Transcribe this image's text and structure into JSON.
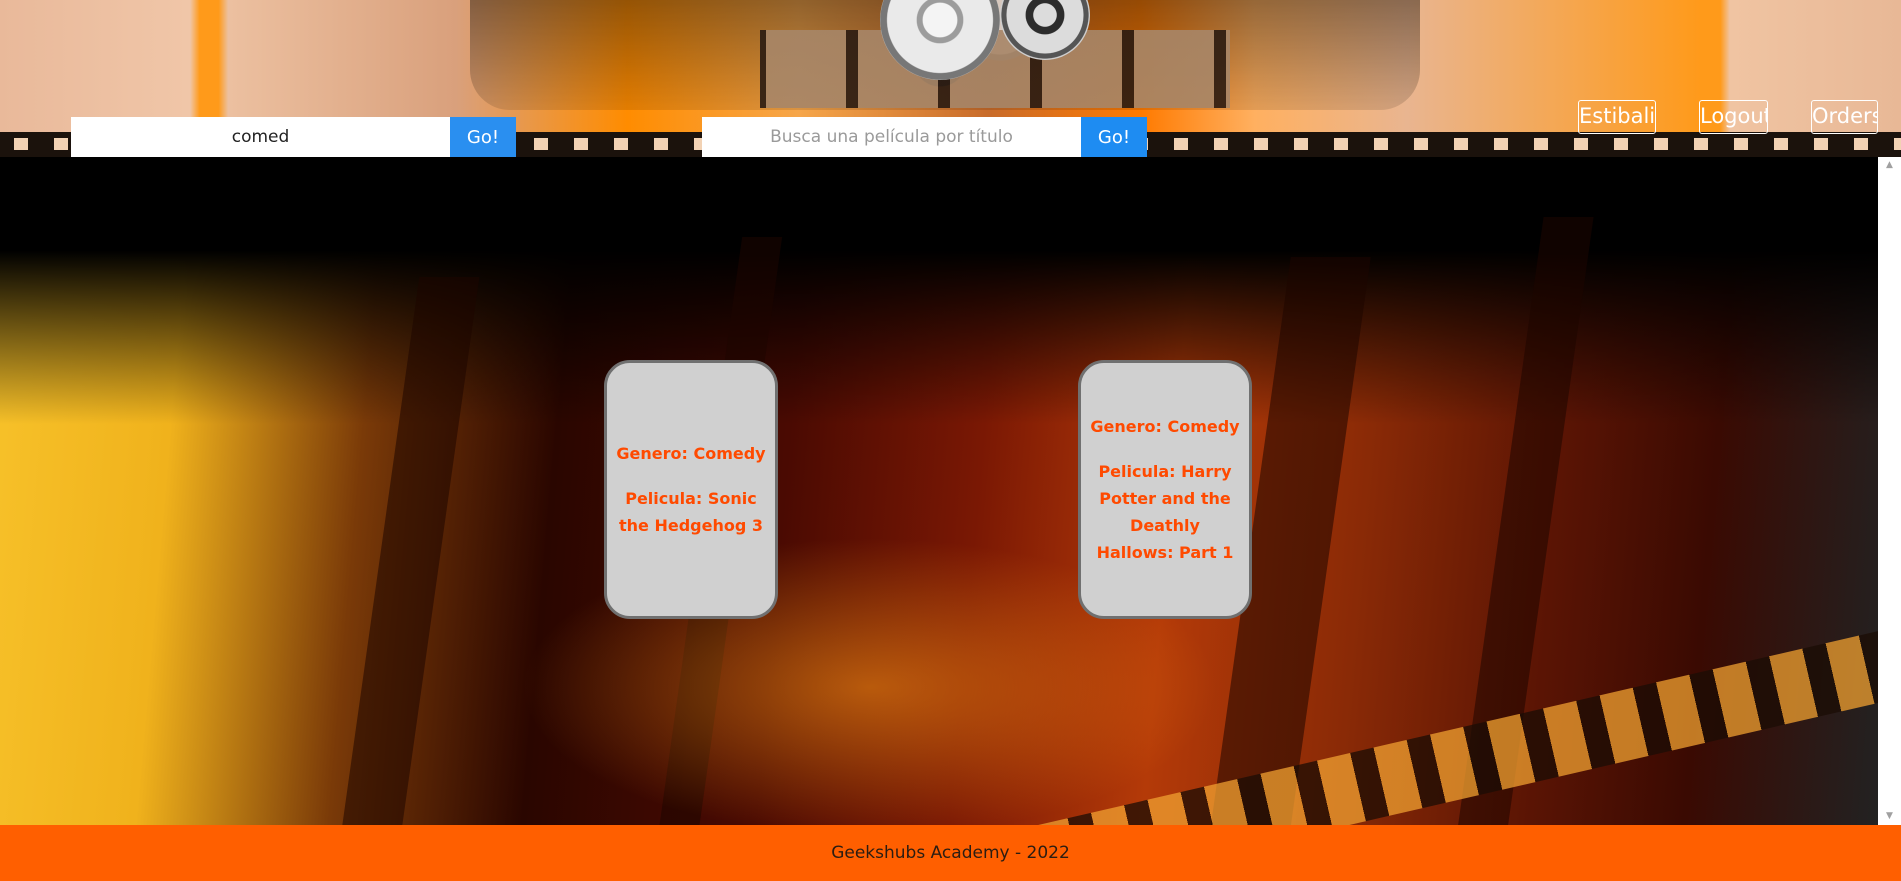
{
  "header": {
    "genre_search": {
      "value": "comed",
      "button_label": "Go!"
    },
    "title_search": {
      "value": "",
      "placeholder": "Busca una película por título",
      "button_label": "Go!"
    },
    "nav": {
      "user_label": "Estibaliz",
      "logout_label": "Logout",
      "orders_label": "Orders"
    }
  },
  "results": [
    {
      "genre": "Genero: Comedy",
      "movie": "Pelicula: Sonic the Hedgehog 3"
    },
    {
      "genre": "Genero: Comedy",
      "movie": "Pelicula: Harry Potter and the Deathly Hallows: Part 1"
    }
  ],
  "footer": {
    "text": "Geekshubs Academy - 2022"
  },
  "colors": {
    "accent_orange": "#ff5f00",
    "button_blue": "#2a8ff0",
    "card_text": "#ff4a00",
    "card_bg": "#d0d0d0"
  },
  "icons": {
    "scroll_up": "scroll-up-arrow-icon",
    "scroll_down": "scroll-down-arrow-icon"
  }
}
